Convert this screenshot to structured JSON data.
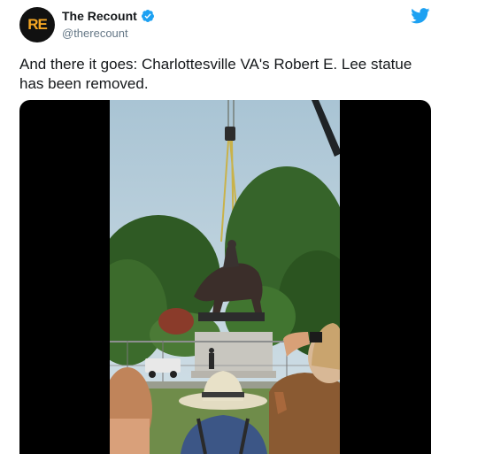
{
  "account": {
    "name": "The Recount",
    "handle": "@therecount",
    "avatar_text": "RE",
    "avatar_bg": "#111111",
    "avatar_fg": "#f5a623",
    "verified_icon": "verified-badge-icon",
    "platform_icon": "twitter-bird-icon",
    "brand_color": "#1da1f2"
  },
  "tweet": {
    "text": "And there it goes: Charlottesville VA's Robert E. Lee statue has been removed."
  },
  "media": {
    "type": "video"
  }
}
